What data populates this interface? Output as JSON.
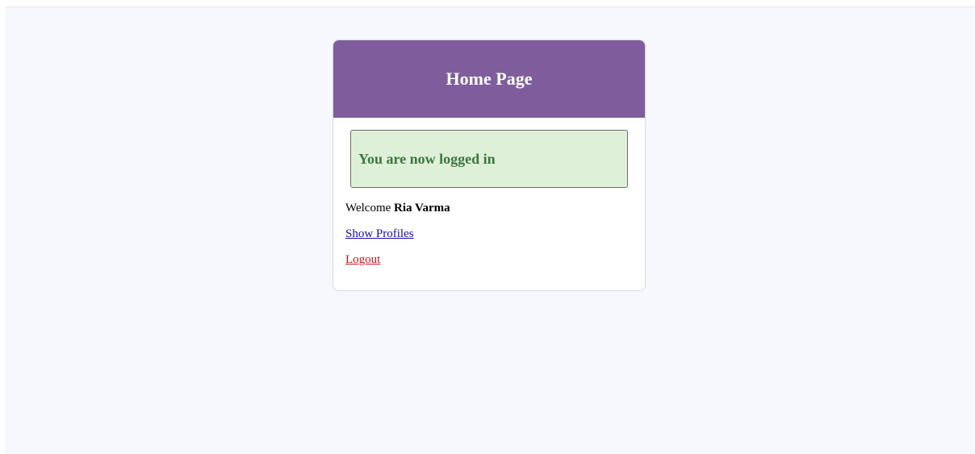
{
  "header": {
    "title": "Home Page"
  },
  "alert": {
    "message": "You are now logged in"
  },
  "welcome": {
    "prefix": "Welcome ",
    "username": "Ria Varma"
  },
  "links": {
    "show_profiles": "Show Profiles",
    "logout": "Logout"
  },
  "colors": {
    "header_bg": "#7f5d9d",
    "alert_bg": "#dff0d8",
    "alert_text": "#3c763d",
    "link": "#1a0dab",
    "logout_link": "#c4161c",
    "page_bg": "#f7f8fd"
  }
}
